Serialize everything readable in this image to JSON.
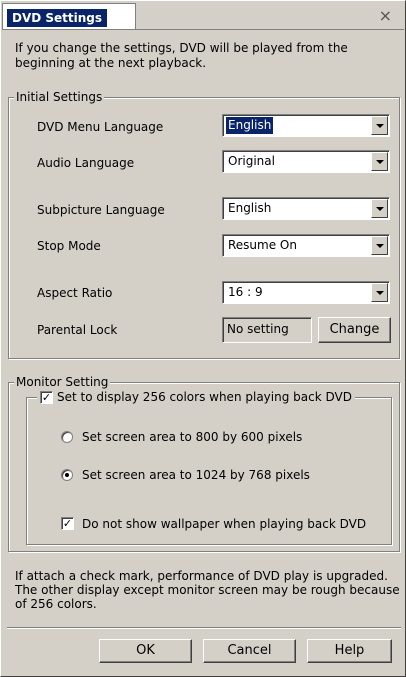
{
  "window": {
    "title": "DVD Settings",
    "close_glyph": "×"
  },
  "intro_text": "If you change the settings, DVD will be played from the beginning at the next playback.",
  "initial_settings": {
    "legend": "Initial Settings",
    "dvd_menu_language": {
      "label": "DVD Menu Language",
      "value": "English"
    },
    "audio_language": {
      "label": "Audio Language",
      "value": "Original"
    },
    "subpicture_language": {
      "label": "Subpicture Language",
      "value": "English"
    },
    "stop_mode": {
      "label": "Stop Mode",
      "value": "Resume On"
    },
    "aspect_ratio": {
      "label": "Aspect Ratio",
      "value": "16 : 9"
    },
    "parental_lock": {
      "label": "Parental Lock",
      "value": "No setting",
      "change_label": "Change"
    }
  },
  "monitor_setting": {
    "legend": "Monitor Setting",
    "colors_256": {
      "label": "Set to display 256 colors when playing back DVD",
      "checked": true,
      "mark": "✓"
    },
    "area_800": {
      "label": "Set screen area to 800 by 600 pixels",
      "selected": false
    },
    "area_1024": {
      "label": "Set screen area to 1024 by 768 pixels",
      "selected": true
    },
    "no_wallpaper": {
      "label": "Do not show wallpaper when playing back DVD",
      "checked": true,
      "mark": "✓"
    }
  },
  "note_text": "If attach a check mark, performance of DVD play is upgraded. The other display except monitor screen may be rough because of 256 colors.",
  "buttons": {
    "ok": "OK",
    "cancel": "Cancel",
    "help": "Help"
  },
  "colors": {
    "face": "#d4d0c8",
    "selection": "#0a246a"
  }
}
